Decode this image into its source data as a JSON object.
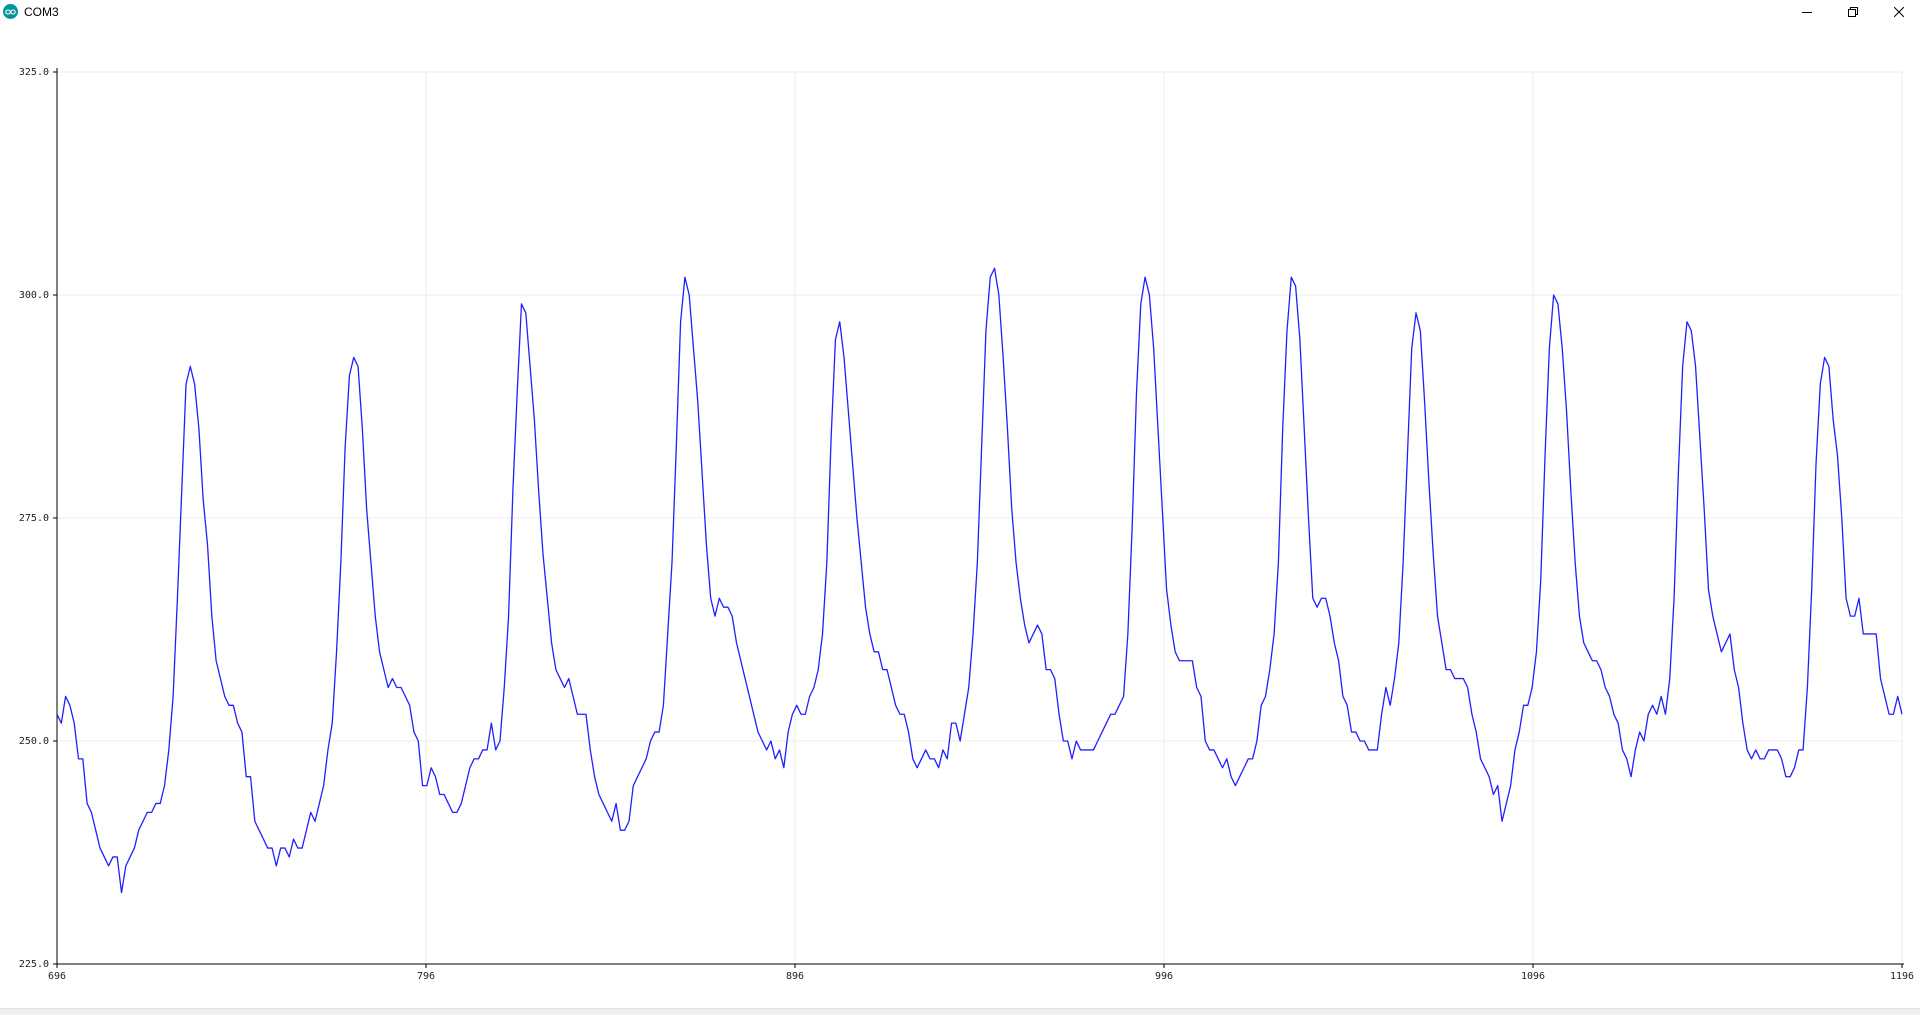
{
  "window": {
    "title": "COM3",
    "icon": "arduino-logo-icon",
    "controls": {
      "minimize_icon": "minimize-icon",
      "maximize_icon": "restore-icon",
      "close_icon": "close-icon"
    }
  },
  "colors": {
    "series": "#2020ff",
    "axis": "#000000",
    "grid": "#eeeeee",
    "brand": "#00979c"
  },
  "chart_data": {
    "type": "line",
    "xlabel": "",
    "ylabel": "",
    "xlim": [
      696,
      1196
    ],
    "ylim": [
      225,
      325
    ],
    "xticks": [
      696,
      796,
      896,
      996,
      1096,
      1196
    ],
    "xtick_labels": [
      "696",
      "796",
      "896",
      "996",
      "1096",
      "1196"
    ],
    "yticks": [
      225,
      250,
      275,
      300,
      325
    ],
    "ytick_labels": [
      "225.0",
      "250.0",
      "275.0",
      "300.0",
      "325.0"
    ],
    "grid": true,
    "x_start": 696,
    "series": [
      {
        "values": [
          253,
          252,
          255,
          254,
          252,
          248,
          248,
          243,
          242,
          240,
          238,
          237,
          236,
          237,
          237,
          233,
          236,
          237,
          238,
          240,
          241,
          242,
          242,
          243,
          243,
          245,
          249,
          255,
          266,
          278,
          290,
          292,
          290,
          285,
          277,
          272,
          264,
          259,
          257,
          255,
          254,
          254,
          252,
          251,
          246,
          246,
          241,
          240,
          239,
          238,
          238,
          236,
          238,
          238,
          237,
          239,
          238,
          238,
          240,
          242,
          241,
          243,
          245,
          249,
          252,
          260,
          270,
          283,
          291,
          293,
          292,
          285,
          276,
          270,
          264,
          260,
          258,
          256,
          257,
          256,
          256,
          255,
          254,
          251,
          250,
          245,
          245,
          247,
          246,
          244,
          244,
          243,
          242,
          242,
          243,
          245,
          247,
          248,
          248,
          249,
          249,
          252,
          249,
          250,
          256,
          264,
          278,
          289,
          299,
          298,
          292,
          286,
          278,
          271,
          266,
          261,
          258,
          257,
          256,
          257,
          255,
          253,
          253,
          253,
          249,
          246,
          244,
          243,
          242,
          241,
          243,
          240,
          240,
          241,
          245,
          246,
          247,
          248,
          250,
          251,
          251,
          254,
          262,
          270,
          283,
          297,
          302,
          300,
          294,
          288,
          280,
          272,
          266,
          264,
          266,
          265,
          265,
          264,
          261,
          259,
          257,
          255,
          253,
          251,
          250,
          249,
          250,
          248,
          249,
          247,
          251,
          253,
          254,
          253,
          253,
          255,
          256,
          258,
          262,
          270,
          284,
          295,
          297,
          293,
          287,
          281,
          275,
          270,
          265,
          262,
          260,
          260,
          258,
          258,
          256,
          254,
          253,
          253,
          251,
          248,
          247,
          248,
          249,
          248,
          248,
          247,
          249,
          248,
          252,
          252,
          250,
          253,
          256,
          262,
          270,
          283,
          296,
          302,
          303,
          300,
          293,
          285,
          276,
          270,
          266,
          263,
          261,
          262,
          263,
          262,
          258,
          258,
          257,
          253,
          250,
          250,
          248,
          250,
          249,
          249,
          249,
          249,
          250,
          251,
          252,
          253,
          253,
          254,
          255,
          262,
          274,
          289,
          299,
          302,
          300,
          294,
          285,
          276,
          267,
          263,
          260,
          259,
          259,
          259,
          259,
          256,
          255,
          250,
          249,
          249,
          248,
          247,
          248,
          246,
          245,
          246,
          247,
          248,
          248,
          250,
          254,
          255,
          258,
          262,
          270,
          285,
          296,
          302,
          301,
          295,
          285,
          275,
          266,
          265,
          266,
          266,
          264,
          261,
          259,
          255,
          254,
          251,
          251,
          250,
          250,
          249,
          249,
          249,
          253,
          256,
          254,
          257,
          261,
          270,
          282,
          294,
          298,
          296,
          288,
          279,
          271,
          264,
          261,
          258,
          258,
          257,
          257,
          257,
          256,
          253,
          251,
          248,
          247,
          246,
          244,
          245,
          241,
          243,
          245,
          249,
          251,
          254,
          254,
          256,
          260,
          268,
          282,
          294,
          300,
          299,
          294,
          287,
          278,
          270,
          264,
          261,
          260,
          259,
          259,
          258,
          256,
          255,
          253,
          252,
          249,
          248,
          246,
          249,
          251,
          250,
          253,
          254,
          253,
          255,
          253,
          257,
          266,
          280,
          292,
          297,
          296,
          292,
          284,
          276,
          267,
          264,
          262,
          260,
          261,
          262,
          258,
          256,
          252,
          249,
          248,
          249,
          248,
          248,
          249,
          249,
          249,
          248,
          246,
          246,
          247,
          249,
          249,
          256,
          267,
          281,
          290,
          293,
          292,
          286,
          282,
          275,
          266,
          264,
          264,
          266,
          262,
          262,
          262,
          262,
          257,
          255,
          253,
          253,
          255,
          253
        ]
      }
    ]
  }
}
